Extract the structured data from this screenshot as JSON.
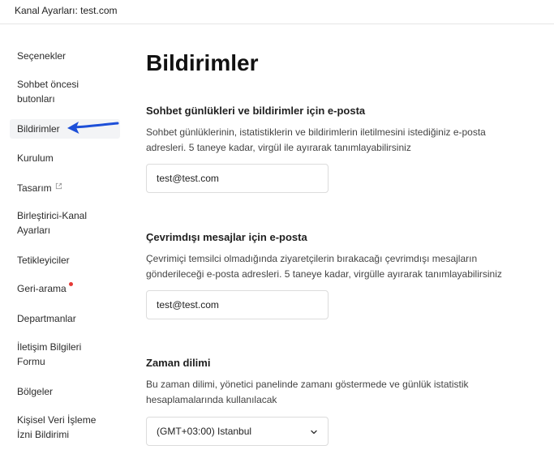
{
  "header": {
    "title": "Kanal Ayarları: test.com"
  },
  "sidebar": {
    "items": [
      {
        "label": "Seçenekler"
      },
      {
        "label": "Sohbet öncesi butonları"
      },
      {
        "label": "Bildirimler",
        "active": true
      },
      {
        "label": "Kurulum"
      },
      {
        "label": "Tasarım",
        "icon": "external-link-icon"
      },
      {
        "label": "Birleştirici-Kanal Ayarları"
      },
      {
        "label": "Tetikleyiciler"
      },
      {
        "label": "Geri-arama",
        "badge": "red-dot"
      },
      {
        "label": "Departmanlar"
      },
      {
        "label": "İletişim Bilgileri Formu"
      },
      {
        "label": "Bölgeler"
      },
      {
        "label": "Kişisel Veri İşleme İzni Bildirimi"
      }
    ]
  },
  "annotation": {
    "icon": "arrow-left-icon",
    "color": "#1d4fd8"
  },
  "main": {
    "title": "Bildirimler",
    "sections": [
      {
        "title": "Sohbet günlükleri ve bildirimler için e-posta",
        "description": "Sohbet günlüklerinin, istatistiklerin ve bildirimlerin iletilmesini istediğiniz e-posta adresleri. 5 taneye kadar, virgül ile ayırarak tanımlayabilirsiniz",
        "value": "test@test.com"
      },
      {
        "title": "Çevrimdışı mesajlar için e-posta",
        "description": "Çevrimiçi temsilci olmadığında ziyaretçilerin bırakacağı çevrimdışı mesajların gönderileceği e-posta adresleri. 5 taneye kadar, virgülle ayırarak tanımlayabilirsiniz",
        "value": "test@test.com"
      },
      {
        "title": "Zaman dilimi",
        "description": "Bu zaman dilimi, yönetici panelinde zamanı göstermede ve günlük istatistik hesaplamalarında kullanılacak",
        "selected": "(GMT+03:00) Istanbul"
      }
    ]
  }
}
